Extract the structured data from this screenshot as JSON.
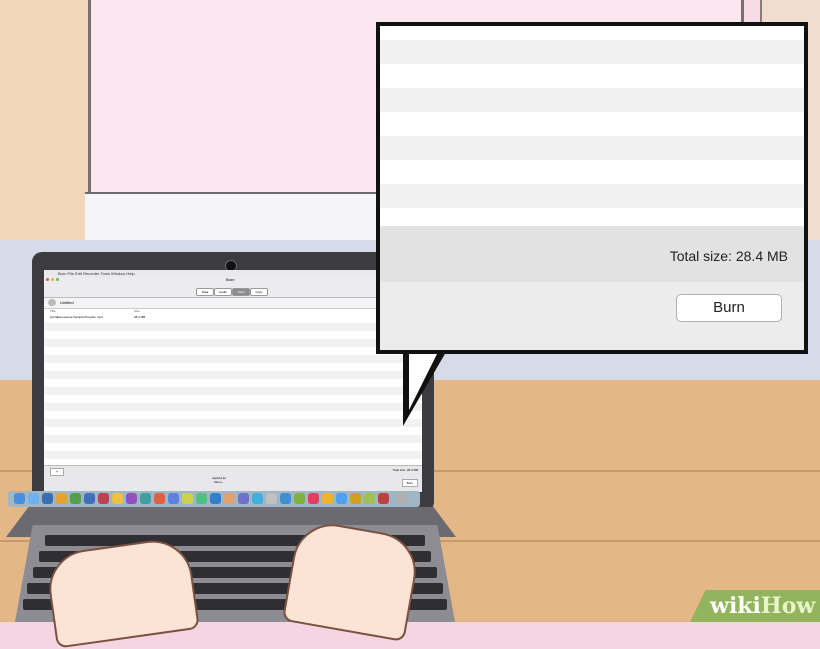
{
  "screen": {
    "menu": "Burn  File  Edit  Recorder  Tools  Window  Help",
    "window_title": "Burn",
    "tabs": [
      "Data",
      "Audio",
      "Video",
      "Copy"
    ],
    "active_tab": "Video",
    "disc_name": "Untitled",
    "list_headers": [
      "Title",
      "Size"
    ],
    "list_item": {
      "name": "printable-resume Sample-Program.mp4",
      "size": "28.4 MB"
    },
    "status_left": "+",
    "status_center": "Applied for\nMenu...",
    "status_right": "Total size: 28.4 MB",
    "burn_small": "Burn"
  },
  "callout": {
    "total_size": "Total size: 28.4 MB",
    "burn_label": "Burn"
  },
  "watermark": {
    "wiki": "wiki",
    "how": "How"
  },
  "colors": {
    "accent_green": "#92b45d",
    "callout_border": "#111111"
  }
}
